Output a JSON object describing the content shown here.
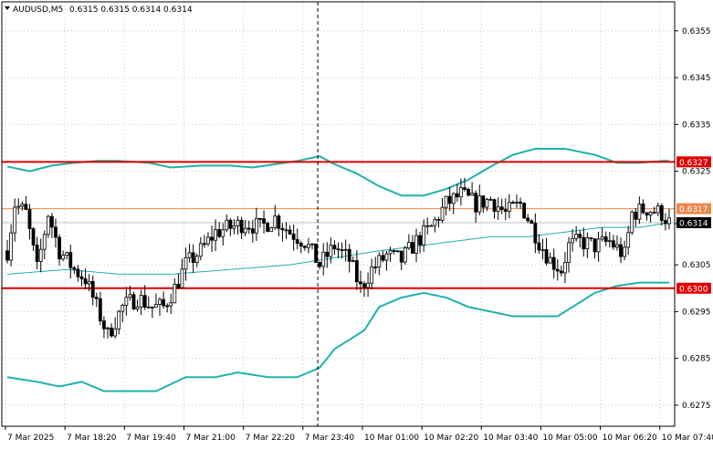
{
  "window": {
    "header": "AUDUSD,M5  0.6315 0.6315 0.6314 0.6314",
    "symbol": "AUDUSD,M5",
    "ohlc": "0.6315 0.6315 0.6314 0.6314",
    "menu_icon": "triangle-down-icon"
  },
  "colors": {
    "background": "#ffffff",
    "bull_body": "#ffffff",
    "bear_body": "#000000",
    "candle_outline": "#000000",
    "bollinger": "#20b2aa",
    "moving_average": "#20b2aa",
    "level_line": "#e00000",
    "bid_line": "#c0c0c0",
    "ask_line": "#e8894a",
    "grid": "#c8c8c8",
    "crosshair": "#000000"
  },
  "chart_data": {
    "type": "candlestick",
    "symbol": "AUDUSD",
    "timeframe": "M5",
    "ylim": [
      0.62705,
      0.63612
    ],
    "y_ticks": [
      "0.6355",
      "0.6345",
      "0.6335",
      "0.6325",
      "0.6314",
      "0.6305",
      "0.6295",
      "0.6285",
      "0.6275"
    ],
    "y_tick_values": [
      0.6355,
      0.6345,
      0.6335,
      0.6325,
      0.63138,
      0.6305,
      0.6295,
      0.6285,
      0.6275
    ],
    "x_ticks": [
      "7 Mar 2025",
      "7 Mar 18:20",
      "7 Mar 19:40",
      "7 Mar 21:00",
      "7 Mar 22:20",
      "7 Mar 23:40",
      "10 Mar 01:00",
      "10 Mar 02:20",
      "10 Mar 03:40",
      "10 Mar 05:00",
      "10 Mar 06:20",
      "10 Mar 07:40"
    ],
    "x_tick_positions": [
      0,
      16,
      32,
      48,
      64,
      80,
      96,
      112,
      128,
      144,
      160,
      176
    ],
    "bar_count": 179,
    "crosshair_bar": 84,
    "price_labels": [
      {
        "text": "0.6327",
        "value": 0.6327,
        "kind": "level"
      },
      {
        "text": "0.6317",
        "value": 0.6317,
        "kind": "ask"
      },
      {
        "text": "0.6314",
        "value": 0.6314,
        "kind": "bid"
      },
      {
        "text": "0.6300",
        "value": 0.63,
        "kind": "level"
      }
    ],
    "horizontal_levels": [
      0.6327,
      0.63
    ],
    "bid": 0.6314,
    "ask": 0.6317,
    "close_anchors": [
      [
        0,
        0.6308
      ],
      [
        2,
        0.6318
      ],
      [
        5,
        0.6316
      ],
      [
        8,
        0.6304
      ],
      [
        11,
        0.6316
      ],
      [
        14,
        0.6308
      ],
      [
        18,
        0.6304
      ],
      [
        21,
        0.6302
      ],
      [
        24,
        0.6296
      ],
      [
        27,
        0.629
      ],
      [
        31,
        0.6296
      ],
      [
        35,
        0.6298
      ],
      [
        39,
        0.6296
      ],
      [
        42,
        0.6296
      ],
      [
        45,
        0.63
      ],
      [
        48,
        0.6305
      ],
      [
        52,
        0.6308
      ],
      [
        56,
        0.6312
      ],
      [
        60,
        0.6313
      ],
      [
        64,
        0.6314
      ],
      [
        68,
        0.6313
      ],
      [
        72,
        0.6315
      ],
      [
        76,
        0.6312
      ],
      [
        80,
        0.631
      ],
      [
        84,
        0.6305
      ],
      [
        88,
        0.6309
      ],
      [
        92,
        0.6306
      ],
      [
        95,
        0.63
      ],
      [
        98,
        0.6304
      ],
      [
        102,
        0.6307
      ],
      [
        106,
        0.6306
      ],
      [
        110,
        0.631
      ],
      [
        114,
        0.6313
      ],
      [
        118,
        0.6318
      ],
      [
        122,
        0.632
      ],
      [
        126,
        0.6318
      ],
      [
        130,
        0.6319
      ],
      [
        134,
        0.6316
      ],
      [
        138,
        0.6318
      ],
      [
        140,
        0.6315
      ],
      [
        143,
        0.631
      ],
      [
        146,
        0.6306
      ],
      [
        149,
        0.6304
      ],
      [
        151,
        0.6309
      ],
      [
        154,
        0.631
      ],
      [
        158,
        0.6309
      ],
      [
        162,
        0.631
      ],
      [
        166,
        0.6307
      ],
      [
        168,
        0.6316
      ],
      [
        172,
        0.6317
      ],
      [
        176,
        0.6316
      ],
      [
        178,
        0.6314
      ]
    ],
    "bollinger_upper_anchors": [
      [
        0,
        0.6326
      ],
      [
        6,
        0.6325
      ],
      [
        12,
        0.63262
      ],
      [
        18,
        0.63268
      ],
      [
        24,
        0.63272
      ],
      [
        30,
        0.63272
      ],
      [
        38,
        0.63268
      ],
      [
        44,
        0.63258
      ],
      [
        52,
        0.63262
      ],
      [
        60,
        0.63262
      ],
      [
        66,
        0.63258
      ],
      [
        72,
        0.63265
      ],
      [
        78,
        0.63272
      ],
      [
        84,
        0.63282
      ],
      [
        88,
        0.63265
      ],
      [
        94,
        0.63245
      ],
      [
        100,
        0.63218
      ],
      [
        106,
        0.63198
      ],
      [
        112,
        0.63198
      ],
      [
        118,
        0.63212
      ],
      [
        124,
        0.63232
      ],
      [
        130,
        0.6326
      ],
      [
        136,
        0.63285
      ],
      [
        142,
        0.63298
      ],
      [
        150,
        0.63298
      ],
      [
        158,
        0.63285
      ],
      [
        164,
        0.63268
      ],
      [
        170,
        0.63268
      ],
      [
        176,
        0.63272
      ],
      [
        178,
        0.63272
      ]
    ],
    "bollinger_lower_anchors": [
      [
        0,
        0.6281
      ],
      [
        8,
        0.628
      ],
      [
        14,
        0.6279
      ],
      [
        20,
        0.628
      ],
      [
        26,
        0.6278
      ],
      [
        32,
        0.6278
      ],
      [
        40,
        0.6278
      ],
      [
        48,
        0.6281
      ],
      [
        56,
        0.6281
      ],
      [
        62,
        0.6282
      ],
      [
        70,
        0.6281
      ],
      [
        78,
        0.6281
      ],
      [
        84,
        0.6283
      ],
      [
        88,
        0.6287
      ],
      [
        92,
        0.6289
      ],
      [
        96,
        0.6291
      ],
      [
        100,
        0.6296
      ],
      [
        106,
        0.6298
      ],
      [
        112,
        0.6299
      ],
      [
        118,
        0.6298
      ],
      [
        124,
        0.6296
      ],
      [
        130,
        0.6295
      ],
      [
        136,
        0.6294
      ],
      [
        142,
        0.6294
      ],
      [
        148,
        0.6294
      ],
      [
        152,
        0.6296
      ],
      [
        158,
        0.6299
      ],
      [
        164,
        0.63005
      ],
      [
        170,
        0.63012
      ],
      [
        178,
        0.63012
      ]
    ],
    "moving_average_anchors": [
      [
        0,
        0.6303
      ],
      [
        16,
        0.6304
      ],
      [
        30,
        0.6303
      ],
      [
        44,
        0.6303
      ],
      [
        60,
        0.6304
      ],
      [
        76,
        0.6305
      ],
      [
        84,
        0.6306
      ],
      [
        92,
        0.6307
      ],
      [
        100,
        0.6308
      ],
      [
        110,
        0.6309
      ],
      [
        120,
        0.631
      ],
      [
        130,
        0.6311
      ],
      [
        140,
        0.6311
      ],
      [
        150,
        0.6312
      ],
      [
        160,
        0.6313
      ],
      [
        170,
        0.6313
      ],
      [
        178,
        0.6314
      ]
    ]
  }
}
